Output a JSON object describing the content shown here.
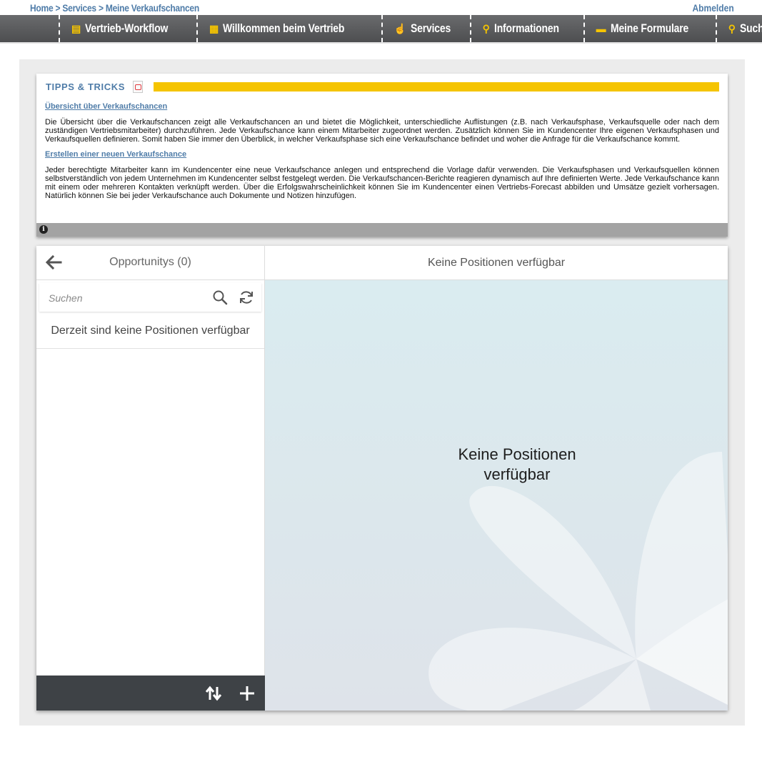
{
  "breadcrumb": {
    "items": [
      "Home",
      "Services",
      "Meine Verkaufschancen"
    ],
    "separator": ">"
  },
  "logout_label": "Abmelden",
  "nav": {
    "items": [
      {
        "label": "Vertrieb-Workflow",
        "icon": "clipboard-icon"
      },
      {
        "label": "Willkommen beim Vertrieb",
        "icon": "buildings-icon"
      },
      {
        "label": "Services",
        "icon": "thumbs-up-icon"
      },
      {
        "label": "Informationen",
        "icon": "location-pin-icon"
      },
      {
        "label": "Meine Formulare",
        "icon": "burger-icon"
      },
      {
        "label": "Suche",
        "icon": "search-icon"
      }
    ],
    "accent": "#f5c400"
  },
  "tips": {
    "title": "TIPPS & TRICKS",
    "sections": [
      {
        "link": "Übersicht über Verkaufschancen",
        "text": "Die Übersicht über die Verkaufschancen zeigt alle Verkaufschancen an und bietet die Möglichkeit, unterschiedliche Auflistungen (z.B. nach Verkaufsphase, Verkaufsquelle oder nach dem zuständigen Vertriebsmitarbeiter) durchzuführen. Jede Verkaufschance kann einem Mitarbeiter zugeordnet werden. Zusätzlich können Sie im Kundencenter Ihre eigenen Verkaufsphasen und Verkaufsquellen definieren. Somit haben Sie immer den Überblick, in welcher Verkaufsphase sich eine Verkaufschance befindet und woher die Anfrage für die Verkaufschance kommt."
      },
      {
        "link": "Erstellen einer neuen Verkaufschance",
        "text": "Jeder berechtigte Mitarbeiter kann im Kundencenter eine neue Verkaufschance anlegen und entsprechend die Vorlage dafür verwenden. Die Verkaufsphasen und Verkaufsquellen können selbstverständlich von jedem Unternehmen im Kundencenter selbst festgelegt werden. Die Verkaufschancen-Berichte reagieren dynamisch auf Ihre definierten Werte. Jede Verkaufschance kann mit einem oder mehreren Kontakten verknüpft werden. Über die Erfolgswahrscheinlichkeit können Sie im Kundencenter einen Vertriebs-Forecast abbilden und Umsätze gezielt vorhersagen. Natürlich können Sie bei jeder Verkaufschance auch Dokumente und Notizen hinzufügen."
      }
    ]
  },
  "list": {
    "title": "Opportunitys (0)",
    "search_placeholder": "Suchen",
    "empty_text": "Derzeit sind keine Positionen verfügbar"
  },
  "detail": {
    "header": "Keine Positionen verfügbar",
    "empty_line1": "Keine Positionen",
    "empty_line2": "verfügbar"
  }
}
